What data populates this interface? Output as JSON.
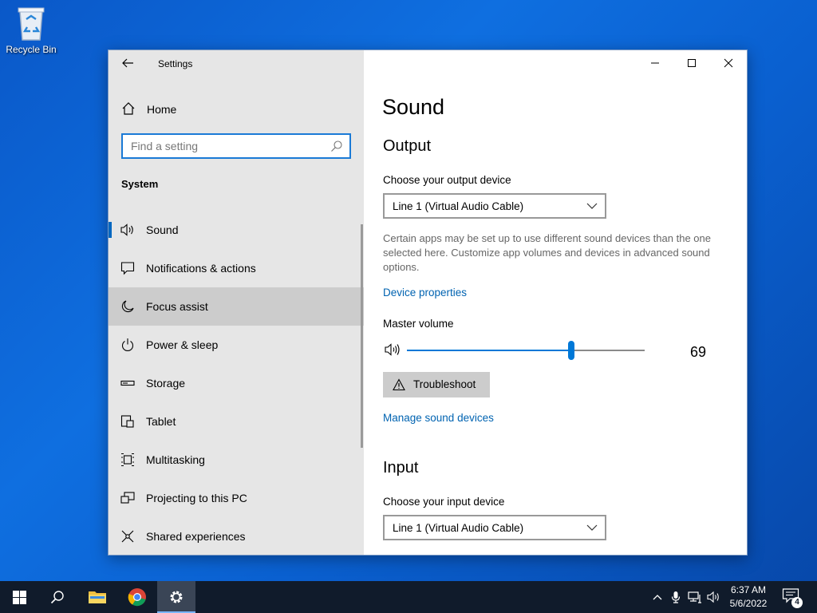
{
  "desktop": {
    "recycle_bin_label": "Recycle Bin"
  },
  "window": {
    "app_title": "Settings",
    "home_label": "Home",
    "search_placeholder": "Find a setting",
    "section_label": "System",
    "nav_items": [
      {
        "label": "Sound",
        "icon": "speaker-icon",
        "state": "selected"
      },
      {
        "label": "Notifications & actions",
        "icon": "notification-icon",
        "state": "normal"
      },
      {
        "label": "Focus assist",
        "icon": "moon-icon",
        "state": "hover"
      },
      {
        "label": "Power & sleep",
        "icon": "power-icon",
        "state": "normal"
      },
      {
        "label": "Storage",
        "icon": "storage-icon",
        "state": "normal"
      },
      {
        "label": "Tablet",
        "icon": "tablet-icon",
        "state": "normal"
      },
      {
        "label": "Multitasking",
        "icon": "multitasking-icon",
        "state": "normal"
      },
      {
        "label": "Projecting to this PC",
        "icon": "projecting-icon",
        "state": "normal"
      },
      {
        "label": "Shared experiences",
        "icon": "shared-experiences-icon",
        "state": "normal"
      }
    ]
  },
  "main": {
    "page_title": "Sound",
    "output": {
      "heading": "Output",
      "device_label": "Choose your output device",
      "device_value": "Line 1 (Virtual Audio Cable)",
      "description": "Certain apps may be set up to use different sound devices than the one selected here. Customize app volumes and devices in advanced sound options.",
      "device_properties_link": "Device properties",
      "master_volume_label": "Master volume",
      "volume": 69,
      "troubleshoot_label": "Troubleshoot",
      "manage_link": "Manage sound devices"
    },
    "input": {
      "heading": "Input",
      "device_label": "Choose your input device",
      "device_value": "Line 1 (Virtual Audio Cable)"
    }
  },
  "taskbar": {
    "time": "6:37 AM",
    "date": "5/6/2022",
    "notification_count": "4"
  },
  "colors": {
    "accent": "#0078d7",
    "link": "#0063b1",
    "sidebar_bg": "#e6e6e6",
    "taskbar_bg": "#101b2b"
  }
}
